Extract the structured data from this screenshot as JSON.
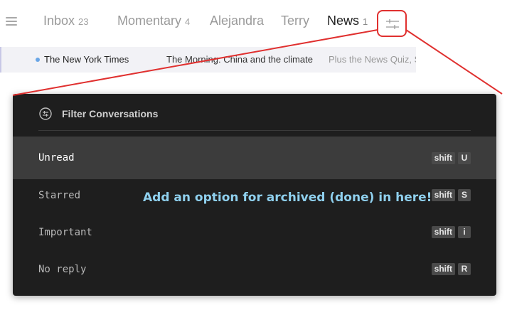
{
  "tabs": [
    {
      "label": "Inbox",
      "count": "23"
    },
    {
      "label": "Momentary",
      "count": "4"
    },
    {
      "label": "Alejandra",
      "count": ""
    },
    {
      "label": "Terry",
      "count": ""
    },
    {
      "label": "News",
      "count": "1"
    }
  ],
  "active_tab": "News",
  "message": {
    "sender": "The New York Times",
    "subject": "The Morning: China and the climate",
    "snippet": "Plus the News Quiz, S"
  },
  "panel": {
    "title": "Filter Conversations",
    "options": [
      {
        "label": "Unread",
        "keys": [
          "shift",
          "U"
        ],
        "selected": true
      },
      {
        "label": "Starred",
        "keys": [
          "shift",
          "S"
        ],
        "selected": false
      },
      {
        "label": "Important",
        "keys": [
          "shift",
          "i"
        ],
        "selected": false
      },
      {
        "label": "No reply",
        "keys": [
          "shift",
          "R"
        ],
        "selected": false
      }
    ]
  },
  "annotation": {
    "text": "Add an option for archived (done) in here!",
    "color": "#8fd0ee",
    "line_color": "#e0302f"
  },
  "icons": {
    "menu": "hamburger-icon",
    "filter": "sliders-icon",
    "panel": "filter-circle-icon"
  }
}
